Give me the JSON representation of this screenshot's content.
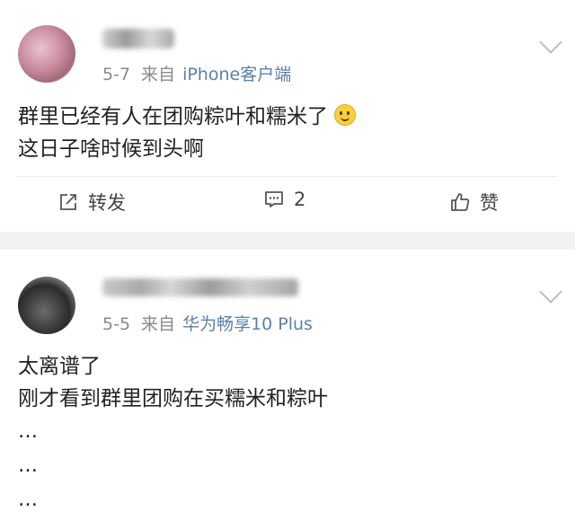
{
  "posts": [
    {
      "date": "5-7",
      "from_label": "来自",
      "source": "iPhone客户端",
      "lines": [
        "群里已经有人在团购粽叶和糯米了",
        "这日子啥时候到头啊"
      ],
      "actions": {
        "repost": "转发",
        "comment_count": "2",
        "like": "赞"
      }
    },
    {
      "date": "5-5",
      "from_label": "来自",
      "source": "华为畅享10 Plus",
      "lines": [
        "太离谱了",
        "刚才看到群里团购在买糯米和粽叶",
        "…",
        "…",
        "…"
      ]
    }
  ],
  "colors": {
    "source_link": "#5d7fa8",
    "meta_text": "#8a8a8a",
    "separator": "#f2f2f2"
  },
  "icons": {
    "expand": "chevron-down-icon",
    "repost": "share-square-icon",
    "comment": "comment-icon",
    "like": "thumbs-up-icon",
    "emoji": "smile-emoji-icon"
  }
}
